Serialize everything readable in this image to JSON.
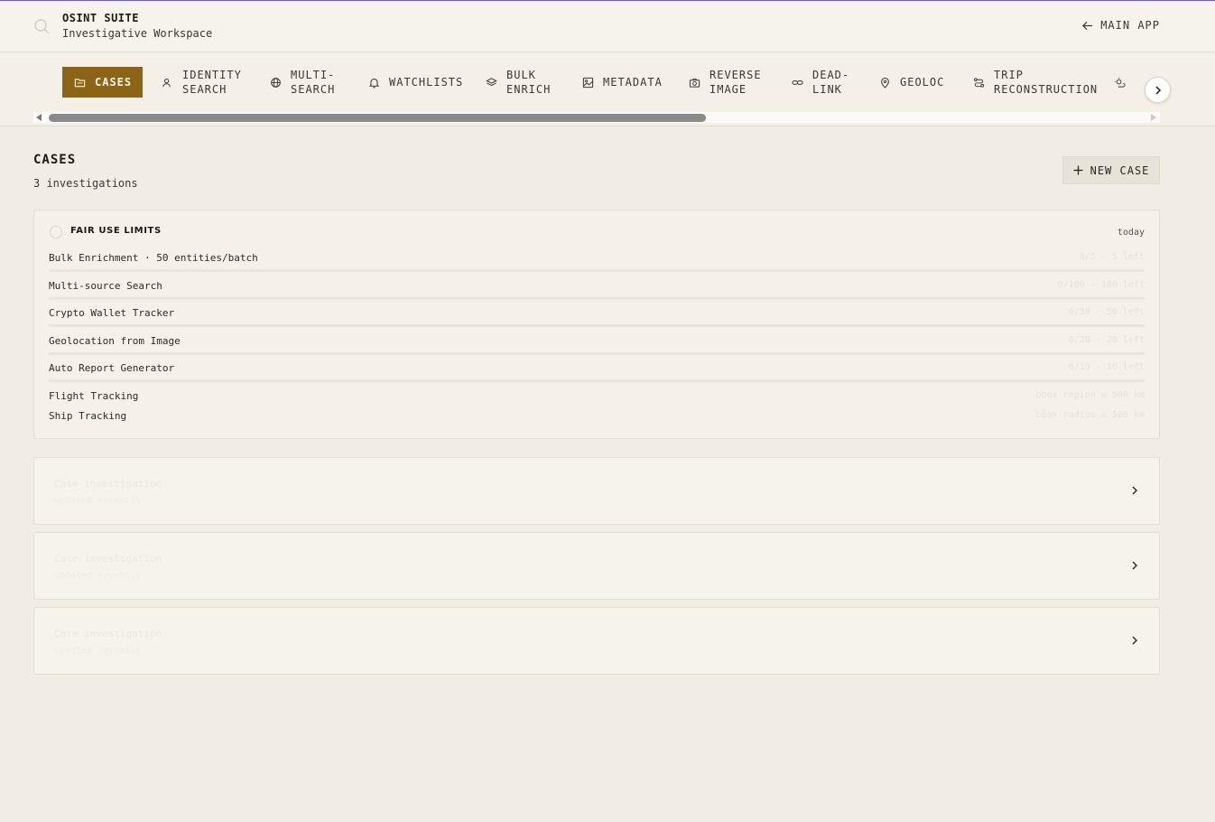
{
  "header": {
    "title": "OSINT SUITE",
    "subtitle": "Investigative Workspace",
    "main_app_label": "MAIN APP"
  },
  "tabs": [
    {
      "label": "CASES",
      "icon": "folder-icon",
      "active": true
    },
    {
      "label": "IDENTITY\nSEARCH",
      "icon": "user-search-icon",
      "active": false
    },
    {
      "label": "MULTI-\nSEARCH",
      "icon": "globe-icon",
      "active": false
    },
    {
      "label": "WATCHLISTS",
      "icon": "bell-icon",
      "active": false
    },
    {
      "label": "BULK\nENRICH",
      "icon": "layers-icon",
      "active": false
    },
    {
      "label": "METADATA",
      "icon": "image-icon",
      "active": false
    },
    {
      "label": "REVERSE\nIMAGE",
      "icon": "camera-icon",
      "active": false
    },
    {
      "label": "DEAD-\nLINK",
      "icon": "link-icon",
      "active": false
    },
    {
      "label": "GEOLOC",
      "icon": "map-pin-icon",
      "active": false
    },
    {
      "label": "TRIP\nRECONSTRUCTION",
      "icon": "route-icon",
      "active": false
    }
  ],
  "page": {
    "title": "CASES",
    "subtitle": "3 investigations",
    "new_case_label": "NEW CASE"
  },
  "limits": {
    "title": "FAIR USE LIMITS",
    "updated": "today",
    "rows": [
      {
        "label": "Bulk Enrichment · 50 entities/batch",
        "usage": "0/5 · 5 left",
        "bar": true
      },
      {
        "label": "Multi-source Search",
        "usage": "0/100 · 100 left",
        "bar": true
      },
      {
        "label": "Crypto Wallet Tracker",
        "usage": "0/50 · 50 left",
        "bar": true
      },
      {
        "label": "Geolocation from Image",
        "usage": "0/20 · 20 left",
        "bar": true
      },
      {
        "label": "Auto Report Generator",
        "usage": "0/10 · 10 left",
        "bar": true
      },
      {
        "label": "Flight Tracking",
        "usage": "bbox region ≤ 500 km",
        "bar": false
      },
      {
        "label": "Ship Tracking",
        "usage": "bbox radius ≤ 500 km",
        "bar": false
      }
    ]
  },
  "cases": [
    {
      "name": "Case investigation",
      "meta": "updated recently"
    },
    {
      "name": "Case investigation",
      "meta": "updated recently"
    },
    {
      "name": "Case investigation",
      "meta": "updated recently"
    }
  ],
  "colors": {
    "accent": "#8c6418",
    "background": "#f1ede4",
    "header_line": "#6a5fb0"
  }
}
